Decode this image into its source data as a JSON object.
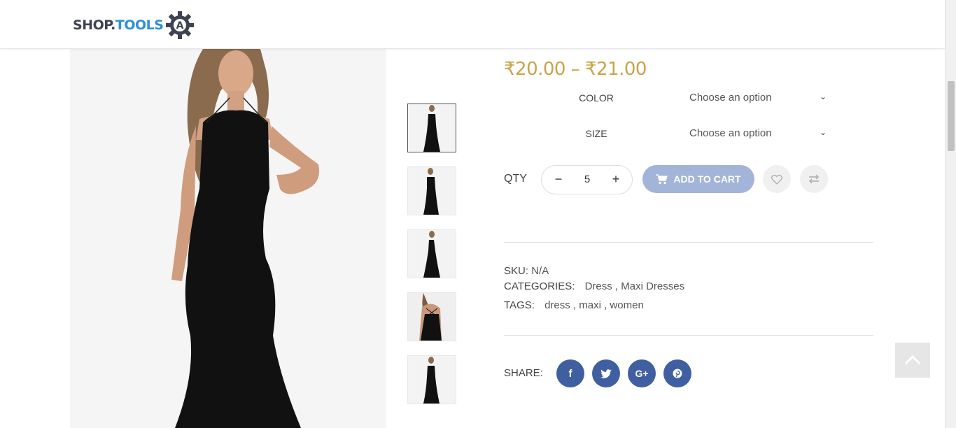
{
  "header": {
    "logo_part1": "SHOP.",
    "logo_part2": "TOOLS",
    "logo_mark": "A"
  },
  "product": {
    "price": "₹20.00 – ₹21.00",
    "variations": [
      {
        "label": "COLOR",
        "value": "Choose an option"
      },
      {
        "label": "SIZE",
        "value": "Choose an option"
      }
    ],
    "qty_label": "QTY",
    "qty_value": "5",
    "qty_minus": "−",
    "qty_plus": "+",
    "add_to_cart": "ADD TO CART",
    "sku_label": "SKU:",
    "sku_value": "N/A",
    "categories_label": "CATEGORIES:",
    "categories": "Dress , Maxi Dresses",
    "tags_label": "TAGS:",
    "tags": "dress , maxi , women",
    "share_label": "SHARE:"
  },
  "icons": {
    "wishlist": "heart-icon",
    "compare": "compare-arrows-icon",
    "cart": "cart-icon",
    "back_to_top": "chevron-up-icon",
    "social": [
      "facebook-icon",
      "twitter-icon",
      "google-plus-icon",
      "pinterest-icon"
    ]
  },
  "colors": {
    "price": "#c9a44a",
    "add_to_cart_bg": "#a2b4d7",
    "social_bg": "#3f5fa0"
  }
}
